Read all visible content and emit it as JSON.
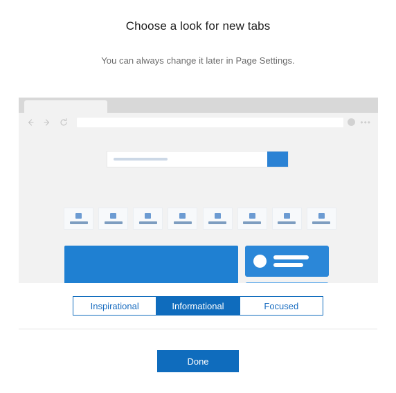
{
  "header": {
    "title": "Choose a look for new tabs",
    "subtitle": "You can always change it later in Page Settings."
  },
  "preview": {
    "browser_chrome": {
      "back_icon": "arrow-left-icon",
      "forward_icon": "arrow-right-icon",
      "refresh_icon": "refresh-icon",
      "address_bar_value": "",
      "avatar_icon": "avatar-icon",
      "more_menu_label": "•••"
    },
    "search": {
      "placeholder": "",
      "button_color": "#2b82d4"
    },
    "tiles_count": 8,
    "cards": {
      "hero_color": "#1f80d2",
      "profile_color": "#2b87d8",
      "light_color": "#66aeec"
    }
  },
  "layout_picker": {
    "options": [
      {
        "label": "Inspirational",
        "selected": false
      },
      {
        "label": "Informational",
        "selected": true
      },
      {
        "label": "Focused",
        "selected": false
      }
    ],
    "accent_color": "#0f6cbd"
  },
  "footer": {
    "done_label": "Done"
  }
}
